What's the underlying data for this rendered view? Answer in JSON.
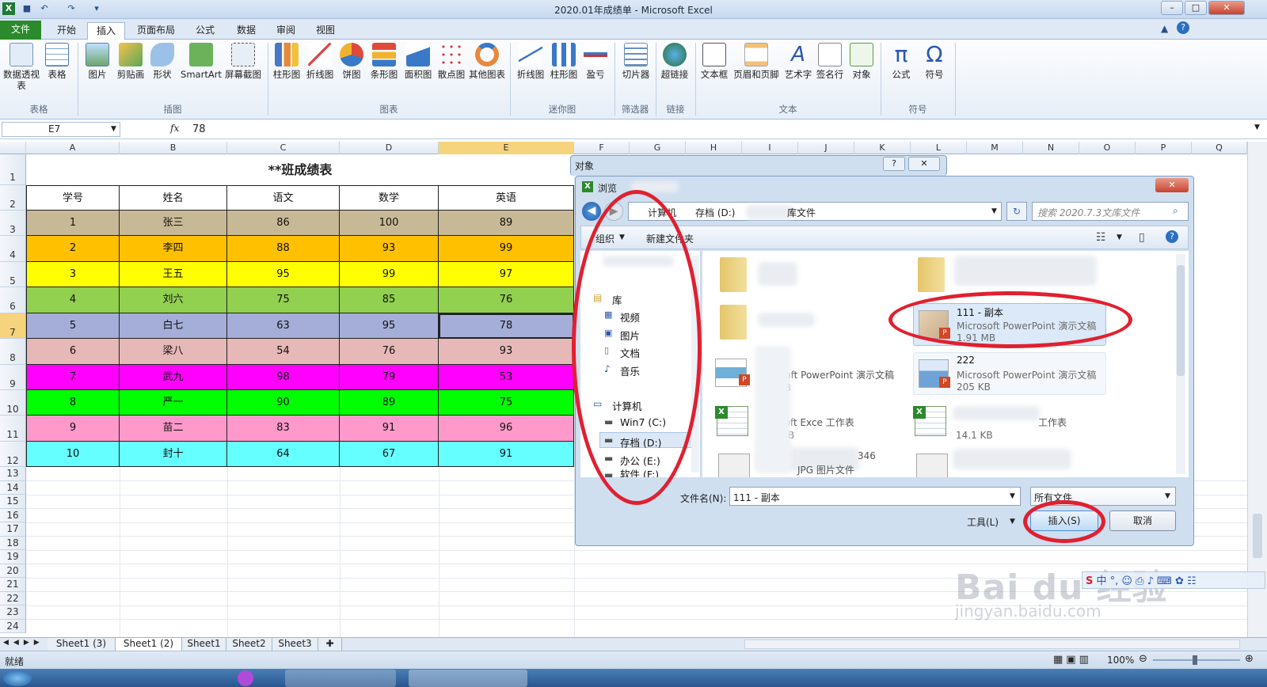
{
  "window": {
    "title": "2020.01年成绩单 - Microsoft Excel"
  },
  "tabs": [
    "文件",
    "开始",
    "插入",
    "页面布局",
    "公式",
    "数据",
    "审阅",
    "视图"
  ],
  "ribbon": {
    "groups": [
      "表格",
      "插图",
      "图表",
      "迷你图",
      "筛选器",
      "链接",
      "文本",
      "符号"
    ],
    "buttons": [
      "数据透视表",
      "表格",
      "图片",
      "剪贴画",
      "形状",
      "SmartArt",
      "屏幕截图",
      "柱形图",
      "折线图",
      "饼图",
      "条形图",
      "面积图",
      "散点图",
      "其他图表",
      "折线图",
      "柱形图",
      "盈亏",
      "切片器",
      "超链接",
      "文本框",
      "页眉和页脚",
      "艺术字",
      "签名行",
      "对象",
      "公式",
      "符号"
    ]
  },
  "formula_bar": {
    "name_box": "E7",
    "fx": "fx",
    "value": "78"
  },
  "columns": [
    "A",
    "B",
    "C",
    "D",
    "E",
    "F",
    "G",
    "H",
    "I",
    "J",
    "K",
    "L",
    "M",
    "N",
    "O",
    "P",
    "Q"
  ],
  "rows": [
    "1",
    "2",
    "3",
    "4",
    "5",
    "6",
    "7",
    "8",
    "9",
    "10",
    "11",
    "12",
    "13",
    "14",
    "15",
    "16",
    "17",
    "18",
    "19",
    "20",
    "21",
    "22",
    "23",
    "24"
  ],
  "sheet": {
    "title": "**班成绩表",
    "headers": [
      "学号",
      "姓名",
      "语文",
      "数学",
      "英语"
    ],
    "rows": [
      [
        "1",
        "张三",
        "86",
        "100",
        "89"
      ],
      [
        "2",
        "李四",
        "88",
        "93",
        "99"
      ],
      [
        "3",
        "王五",
        "95",
        "99",
        "97"
      ],
      [
        "4",
        "刘六",
        "75",
        "85",
        "76"
      ],
      [
        "5",
        "白七",
        "63",
        "95",
        "78"
      ],
      [
        "6",
        "梁八",
        "54",
        "76",
        "93"
      ],
      [
        "7",
        "武九",
        "98",
        "79",
        "53"
      ],
      [
        "8",
        "严一",
        "90",
        "89",
        "75"
      ],
      [
        "9",
        "苗二",
        "83",
        "91",
        "96"
      ],
      [
        "10",
        "封十",
        "64",
        "67",
        "91"
      ]
    ],
    "row_colors": [
      "#c8b996",
      "#ffc000",
      "#ffff00",
      "#92d050",
      "#a4aed8",
      "#e6b8b7",
      "#ff00ff",
      "#00ff00",
      "#ff99cc",
      "#66ffff"
    ]
  },
  "object_dialog": {
    "title": "对象",
    "help": "?",
    "close": "✕"
  },
  "browse_dialog": {
    "title": "浏览",
    "breadcrumb": [
      "计算机",
      "存档 (D:)",
      "库文件"
    ],
    "search_placeholder": "搜索 2020.7.3文库文件",
    "toolbar": {
      "organize": "组织",
      "new_folder": "新建文件夹"
    },
    "nav": {
      "library": "库",
      "lib_items": [
        "视频",
        "图片",
        "文档",
        "音乐"
      ],
      "computer": "计算机",
      "drives": [
        "Win7 (C:)",
        "存档 (D:)",
        "办公 (E:)",
        "软件 (F:)"
      ]
    },
    "files": [
      {
        "name": "111 - 副本",
        "type": "Microsoft PowerPoint 演示文稿",
        "size": "1.91 MB"
      },
      {
        "name": "222",
        "type": "Microsoft PowerPoint 演示文稿",
        "size": "205 KB"
      },
      {
        "name": "",
        "type": "rosoft PowerPoint 演示文稿",
        "size": "KB"
      },
      {
        "name": "",
        "type": "osoft Exce 工作表",
        "size": "KB"
      },
      {
        "name": "",
        "type": "工作表",
        "size": "14.1 KB"
      },
      {
        "name": "",
        "type": "JPG 图片文件",
        "size": "346"
      }
    ],
    "filename_label": "文件名(N):",
    "filename_value": "111 - 副本",
    "filter": "所有文件",
    "tools": "工具(L)",
    "insert": "插入(S)",
    "cancel": "取消"
  },
  "sheet_tabs": [
    "Sheet1 (3)",
    "Sheet1 (2)",
    "Sheet1",
    "Sheet2",
    "Sheet3"
  ],
  "status": {
    "ready": "就绪",
    "zoom": "100%"
  },
  "watermark": {
    "brand": "Bai du 经验",
    "url": "jingyan.baidu.com"
  },
  "colors": {
    "excel_green": "#2b8a2b",
    "annotation_red": "#e02030",
    "title_bg": "#dce8f6"
  }
}
